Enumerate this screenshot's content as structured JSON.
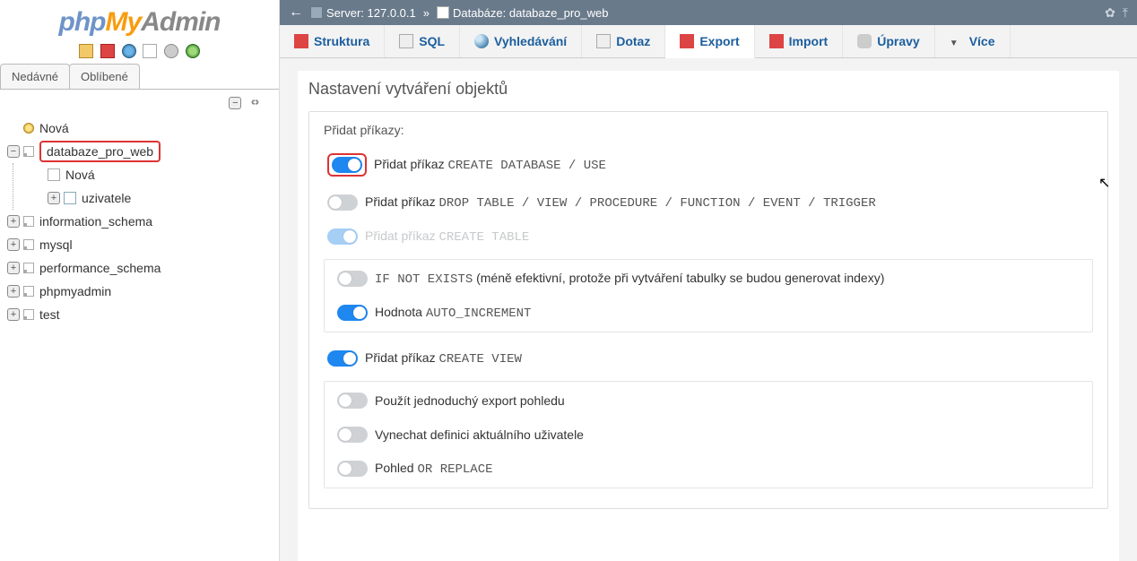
{
  "logo": {
    "php": "php",
    "my": "My",
    "admin": "Admin"
  },
  "sidebar_tabs": {
    "recent": "Nedávné",
    "favorites": "Oblíbené"
  },
  "tree": {
    "new": "Nová",
    "selected_db": "databaze_pro_web",
    "selected_new": "Nová",
    "selected_table": "uzivatele",
    "dbs": [
      "information_schema",
      "mysql",
      "performance_schema",
      "phpmyadmin",
      "test"
    ]
  },
  "breadcrumb": {
    "server_label": "Server:",
    "server_value": "127.0.0.1",
    "db_label": "Databáze:",
    "db_value": "databaze_pro_web"
  },
  "tabs": {
    "structure": "Struktura",
    "sql": "SQL",
    "search": "Vyhledávání",
    "query": "Dotaz",
    "export": "Export",
    "import": "Import",
    "operations": "Úpravy",
    "more": "Více"
  },
  "section_title": "Nastavení vytváření objektů",
  "legend": "Přidat příkazy:",
  "opts": {
    "create_db_pre": "Přidat příkaz ",
    "create_db_code": "CREATE DATABASE / USE",
    "drop_pre": "Přidat příkaz ",
    "drop_code": "DROP TABLE / VIEW / PROCEDURE / FUNCTION / EVENT / TRIGGER",
    "create_tbl_pre": "Přidat příkaz ",
    "create_tbl_code": "CREATE TABLE",
    "ifnotexists_code": "IF NOT EXISTS",
    "ifnotexists_note": " (méně efektivní, protože při vytváření tabulky se budou generovat indexy)",
    "autoinc_pre": "Hodnota ",
    "autoinc_code": "AUTO_INCREMENT",
    "create_view_pre": "Přidat příkaz ",
    "create_view_code": "CREATE VIEW",
    "simple_export": "Použít jednoduchý export pohledu",
    "skip_definer": "Vynechat definici aktuálního uživatele",
    "view_or_replace_pre": "Pohled ",
    "view_or_replace_code": "OR REPLACE"
  }
}
